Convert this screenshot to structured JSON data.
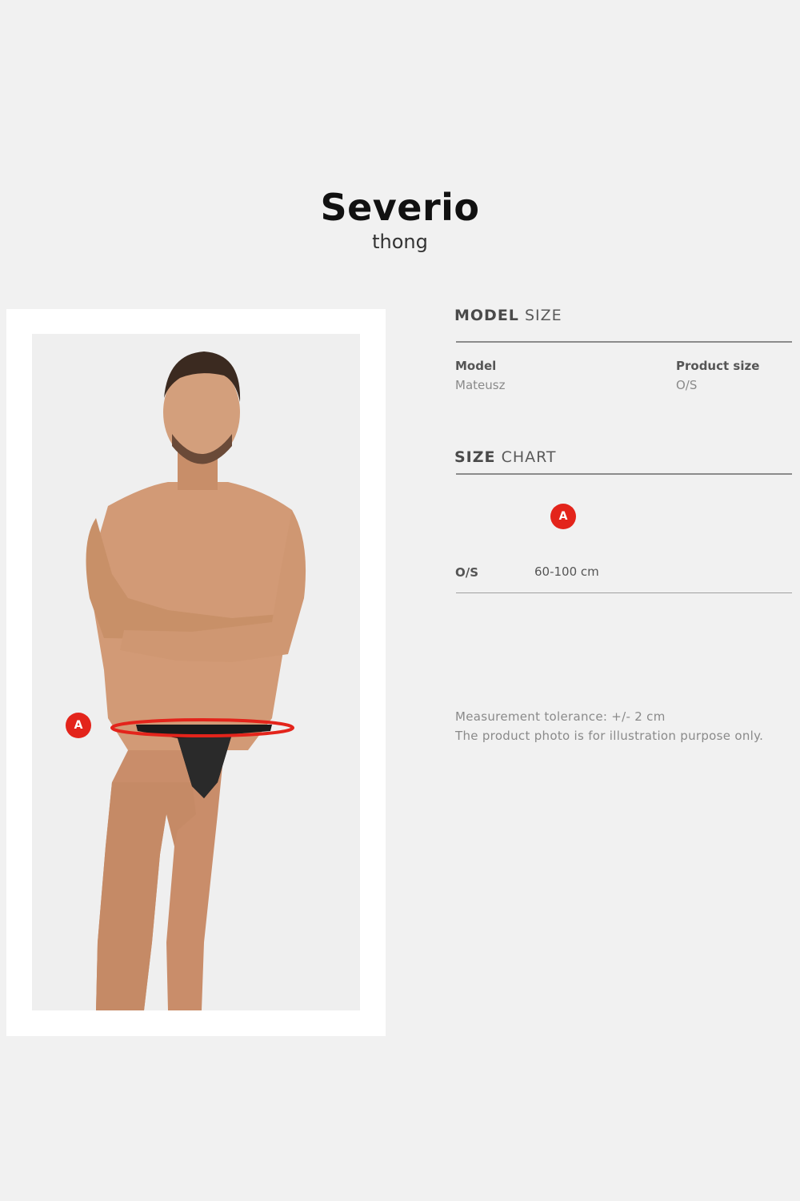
{
  "header": {
    "title": "Severio",
    "subtitle": "thong"
  },
  "photo": {
    "marker": "A",
    "image": "model-photo"
  },
  "model_size": {
    "heading_bold": "MODEL",
    "heading_light": "SIZE",
    "model_label": "Model",
    "model_value": "Mateusz",
    "size_label": "Product size",
    "size_value": "O/S"
  },
  "size_chart": {
    "heading_bold": "SIZE",
    "heading_light": "CHART",
    "marker": "A",
    "rows": [
      {
        "size": "O/S",
        "measure": "60-100 cm"
      }
    ]
  },
  "notes": [
    "Measurement tolerance: +/- 2 cm",
    "The product photo is for illustration purpose only."
  ],
  "colors": {
    "accent": "#e3241b",
    "background": "#f1f1f1"
  }
}
